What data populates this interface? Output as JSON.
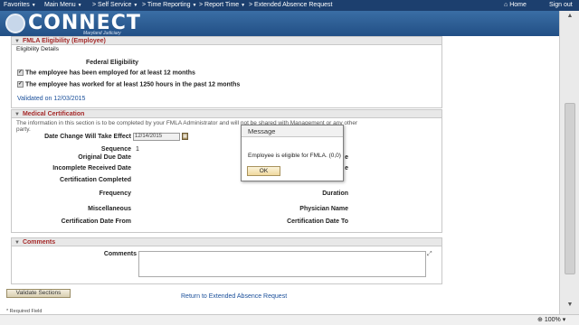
{
  "topnav": {
    "favorites": "Favorites",
    "main_menu": "Main Menu",
    "self_service": "Self Service",
    "time_reporting": "Time Reporting",
    "report_time": "Report Time",
    "current_page": "Extended Absence Request",
    "home": "Home",
    "sign_out": "Sign out",
    "sep": ">"
  },
  "banner": {
    "logo": "CONNECT",
    "logo_sub": "Maryland Judiciary"
  },
  "fmla": {
    "title": "FMLA Eligibility (Employee)",
    "details_label": "Eligibility Details",
    "federal_label": "Federal Eligibility",
    "check1": "The employee has been employed for at least 12 months",
    "check2": "The employee has worked for at least 1250 hours in the past 12 months",
    "validated": "Validated on 12/03/2015"
  },
  "medical": {
    "title": "Medical Certification",
    "note_line1": "The information in this section is to be completed by your FMLA Administrator and will not be shared with Management or any other",
    "note_line2": "party.",
    "date_change_label": "Date Change Will Take Effect",
    "date_change_value": "12/14/2015",
    "sequence_label": "Sequence",
    "sequence_value": "1",
    "original_due_label": "Original Due Date",
    "incomplete_received_label": "Incomplete Received Date",
    "cert_completed_label": "Certification Completed",
    "frequency_label": "Frequency",
    "duration_label": "Duration",
    "misc_label": "Miscellaneous",
    "physician_label": "Physician Name",
    "cert_from_label": "Certification Date From",
    "cert_to_label": "Certification Date To",
    "right_partial1": "e",
    "right_partial2": "e"
  },
  "comments": {
    "title": "Comments",
    "label": "Comments",
    "value": ""
  },
  "footer": {
    "validate_button": "Validate Sections",
    "return_link": "Return to Extended Absence Request",
    "required_note": "* Required Field"
  },
  "modal": {
    "title": "Message",
    "message": "Employee is eligible for FMLA. (0,0)",
    "ok": "OK"
  },
  "statusbar": {
    "zoom": "100%"
  },
  "colors": {
    "nav": "#1c3f6e",
    "section_title": "#a52a2a",
    "link": "#1a4f9a"
  }
}
